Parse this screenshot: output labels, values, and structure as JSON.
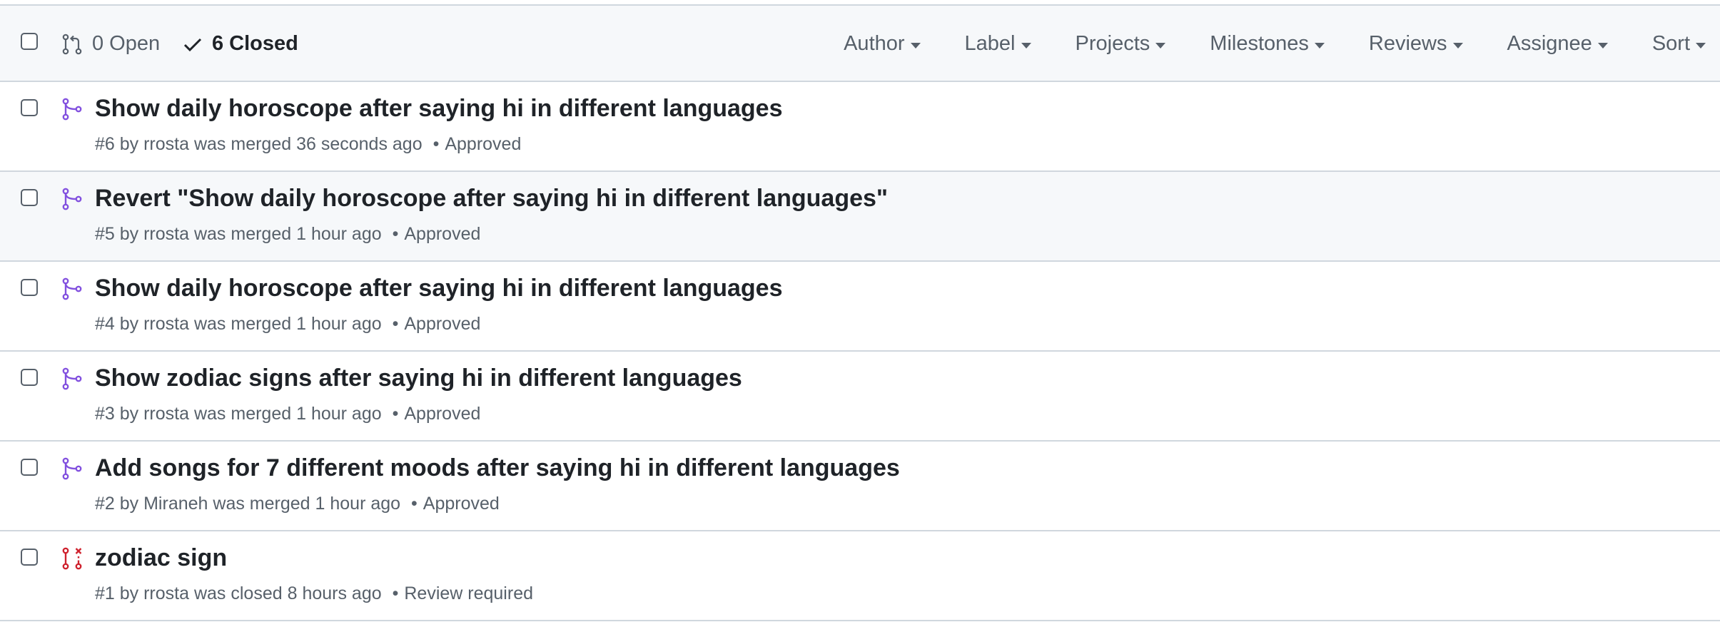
{
  "header": {
    "open_label": "0 Open",
    "closed_label": "6 Closed",
    "filters": [
      "Author",
      "Label",
      "Projects",
      "Milestones",
      "Reviews",
      "Assignee",
      "Sort"
    ]
  },
  "colors": {
    "merged": "#8250df",
    "closed": "#cf222e",
    "muted": "#57606a",
    "text": "#1f2328",
    "border": "#d0d7de"
  },
  "pull_requests": [
    {
      "title": "Show daily horoscope after saying hi in different languages",
      "number": "#6",
      "author": "rrosta",
      "action": "was merged",
      "time": "36 seconds ago",
      "review": "Approved",
      "status": "merged",
      "icon": "git-merge-icon"
    },
    {
      "title": "Revert \"Show daily horoscope after saying hi in different languages\"",
      "number": "#5",
      "author": "rrosta",
      "action": "was merged",
      "time": "1 hour ago",
      "review": "Approved",
      "status": "merged",
      "icon": "git-merge-icon"
    },
    {
      "title": "Show daily horoscope after saying hi in different languages",
      "number": "#4",
      "author": "rrosta",
      "action": "was merged",
      "time": "1 hour ago",
      "review": "Approved",
      "status": "merged",
      "icon": "git-merge-icon"
    },
    {
      "title": "Show zodiac signs after saying hi in different languages",
      "number": "#3",
      "author": "rrosta",
      "action": "was merged",
      "time": "1 hour ago",
      "review": "Approved",
      "status": "merged",
      "icon": "git-merge-icon"
    },
    {
      "title": "Add songs for 7 different moods after saying hi in different languages",
      "number": "#2",
      "author": "Miraneh",
      "action": "was merged",
      "time": "1 hour ago",
      "review": "Approved",
      "status": "merged",
      "icon": "git-merge-icon"
    },
    {
      "title": "zodiac sign",
      "number": "#1",
      "author": "rrosta",
      "action": "was closed",
      "time": "8 hours ago",
      "review": "Review required",
      "status": "closed",
      "icon": "git-pull-request-closed-icon"
    }
  ]
}
